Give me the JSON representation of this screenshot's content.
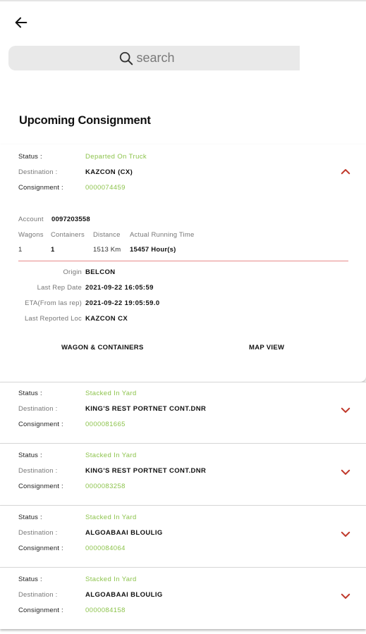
{
  "search": {
    "placeholder": "search"
  },
  "section_title": "Upcoming Consignment",
  "labels": {
    "status": "Status :",
    "destination": "Destination :",
    "consignment": "Consignment :"
  },
  "expanded": {
    "status": "Departed On Truck",
    "destination": "KAZCON (CX)",
    "consignment": "0000074459",
    "account_label": "Account",
    "account_value": "0097203558",
    "headers": {
      "wagons": "Wagons",
      "containers": "Containers",
      "distance": "Distance",
      "running_time": "Actual Running Time"
    },
    "values": {
      "wagons": "1",
      "containers": "1",
      "distance": "1513 Km",
      "running_time": "15457 Hour(s)"
    },
    "origin_label": "Origin",
    "origin_value": "BELCON",
    "last_rep_label": "Last Rep Date",
    "last_rep_value": "2021-09-22 16:05:59",
    "eta_label": "ETA(From las rep)",
    "eta_value": "2021-09-22 19:05:59.0",
    "last_loc_label": "Last Reported Loc",
    "last_loc_value": "KAZCON CX",
    "btn_wagons": "WAGON & CONTAINERS",
    "btn_map": "MAP VIEW"
  },
  "cards": [
    {
      "status": "Stacked In Yard",
      "destination": "KING'S REST PORTNET CONT.DNR",
      "consignment": "0000081665"
    },
    {
      "status": "Stacked In Yard",
      "destination": "KING'S REST PORTNET CONT.DNR",
      "consignment": "0000083258"
    },
    {
      "status": "Stacked In Yard",
      "destination": "ALGOABAAI BLOULIG",
      "consignment": "0000084064"
    },
    {
      "status": "Stacked In Yard",
      "destination": "ALGOABAAI BLOULIG",
      "consignment": "0000084158"
    }
  ],
  "colors": {
    "accent_green": "#8cc34b",
    "chevron_red": "#c0392b",
    "divider_red": "#e78a8a"
  }
}
